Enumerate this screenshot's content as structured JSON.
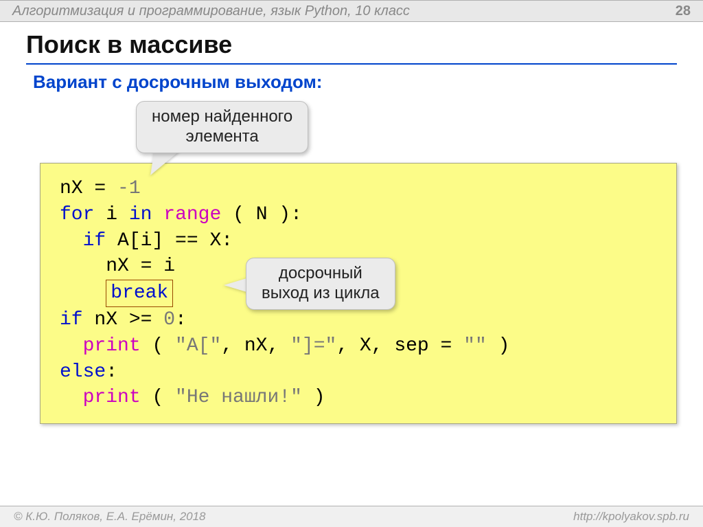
{
  "header": {
    "course": "Алгоритмизация и программирование, язык Python, 10 класс",
    "page": "28"
  },
  "title": "Поиск в массиве",
  "subheading": "Вариант с досрочным выходом:",
  "callouts": {
    "found_index_label_l1": "номер найденного",
    "found_index_label_l2": "элемента",
    "early_exit_l1": "досрочный",
    "early_exit_l2": "выход из цикла"
  },
  "code": {
    "l1_a": "nX = ",
    "l1_b": "-1",
    "l2_a": "for",
    "l2_b": " i ",
    "l2_c": "in",
    "l2_d": " ",
    "l2_e": "range",
    "l2_f": " ( N ):",
    "l3_a": "  ",
    "l3_b": "if",
    "l3_c": " A[i] == X:",
    "l4": "    nX = i",
    "l5_pad": "    ",
    "l5_kw": "break",
    "l6_a": "if",
    "l6_b": " nX >= ",
    "l6_c": "0",
    "l6_d": ":",
    "l7_a": "  ",
    "l7_b": "print",
    "l7_c": " ( ",
    "l7_d": "\"A[\"",
    "l7_e": ", nX, ",
    "l7_f": "\"]=\"",
    "l7_g": ", X, sep = ",
    "l7_h": "\"\"",
    "l7_i": " )",
    "l8_a": "else",
    "l8_b": ":",
    "l9_a": "  ",
    "l9_b": "print",
    "l9_c": " ( ",
    "l9_d": "\"Не нашли!\"",
    "l9_e": " )"
  },
  "footer": {
    "authors": "© К.Ю. Поляков, Е.А. Ерёмин, 2018",
    "url": "http://kpolyakov.spb.ru"
  }
}
